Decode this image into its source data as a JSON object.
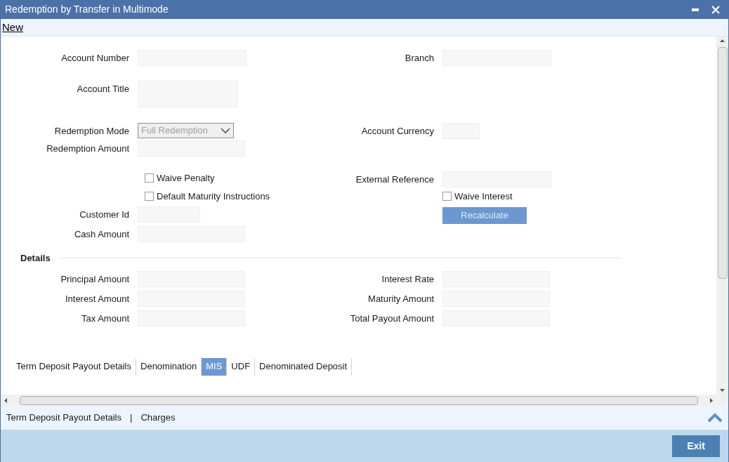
{
  "window": {
    "title": "Redemption by Transfer in Multimode"
  },
  "toolbar": {
    "new_link": "New"
  },
  "form": {
    "rows": [
      [
        {
          "kind": "text",
          "label": "Account Number"
        },
        {
          "kind": "text",
          "label": "Branch"
        }
      ],
      [
        {
          "kind": "text",
          "label": "Account Title"
        },
        null
      ],
      [
        {
          "kind": "select",
          "label": "Redemption Mode",
          "value": "Full Redemption",
          "disabled": true
        },
        {
          "kind": "text",
          "label": "Account Currency"
        }
      ],
      [
        {
          "kind": "text",
          "label": "Redemption Amount"
        },
        null
      ],
      [
        {
          "kind": "checkbox",
          "label": "Waive Penalty",
          "checked": false
        },
        {
          "kind": "text",
          "label": "External Reference"
        }
      ],
      [
        {
          "kind": "checkbox",
          "label": "Default Maturity Instructions",
          "checked": false
        },
        {
          "kind": "checkbox",
          "label": "Waive Interest",
          "checked": false
        }
      ],
      [
        {
          "kind": "text",
          "label": "Customer Id"
        },
        {
          "kind": "button",
          "label": "Recalculate",
          "disabled": true
        }
      ],
      [
        {
          "kind": "text",
          "label": "Cash Amount"
        },
        null
      ]
    ]
  },
  "details": {
    "title": "Details",
    "rows": [
      [
        {
          "kind": "text",
          "label": "Principal Amount"
        },
        {
          "kind": "text",
          "label": "Interest Rate"
        }
      ],
      [
        {
          "kind": "text",
          "label": "Interest Amount"
        },
        {
          "kind": "text",
          "label": "Maturity Amount"
        }
      ],
      [
        {
          "kind": "text",
          "label": "Tax Amount"
        },
        {
          "kind": "text",
          "label": "Total Payout Amount"
        }
      ]
    ]
  },
  "tabs": [
    {
      "label": "Term Deposit Payout Details",
      "selected": false
    },
    {
      "label": "Denomination",
      "selected": false
    },
    {
      "label": "MIS",
      "selected": true
    },
    {
      "label": "UDF",
      "selected": false
    },
    {
      "label": "Denominated Deposit",
      "selected": false
    }
  ],
  "bottom_links": [
    "Term Deposit Payout Details",
    "Charges"
  ],
  "bottom_link_separator": "|",
  "footer": {
    "exit_button": "Exit"
  }
}
